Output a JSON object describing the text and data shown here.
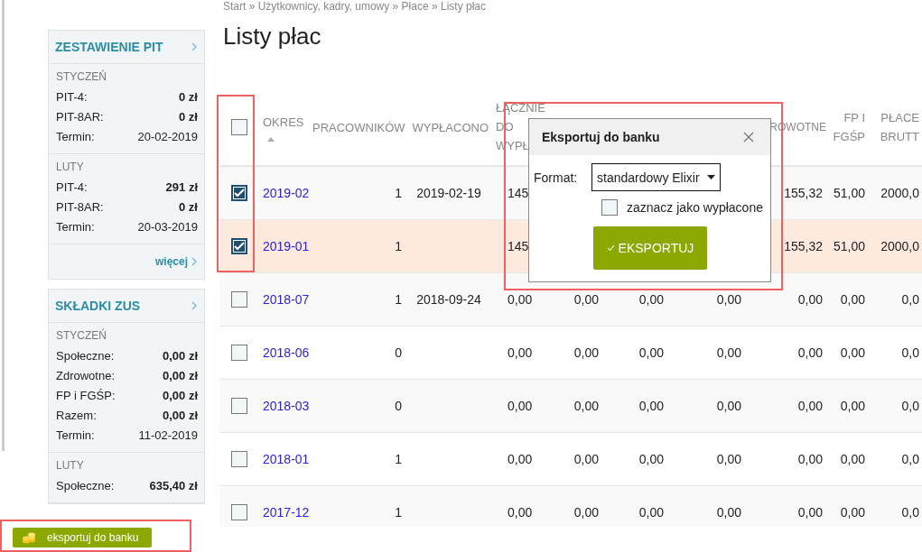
{
  "breadcrumb": "Start » Użytkownicy, kadry, umowy » Płace » Listy płac",
  "sidebar": {
    "panels": [
      {
        "title": "ZESTAWIENIE PIT",
        "sections": [
          {
            "heading": "STYCZEŃ",
            "rows": [
              {
                "label": "PIT-4:",
                "value": "0 zł",
                "bold": true
              },
              {
                "label": "PIT-8AR:",
                "value": "0 zł",
                "bold": true
              },
              {
                "label": "Termin:",
                "value": "20-02-2019",
                "bold": false
              }
            ]
          },
          {
            "heading": "LUTY",
            "rows": [
              {
                "label": "PIT-4:",
                "value": "291 zł",
                "bold": true
              },
              {
                "label": "PIT-8AR:",
                "value": "0 zł",
                "bold": true
              },
              {
                "label": "Termin:",
                "value": "20-03-2019",
                "bold": false
              }
            ]
          }
        ],
        "more": "więcej"
      },
      {
        "title": "SKŁADKI ZUS",
        "sections": [
          {
            "heading": "STYCZEŃ",
            "rows": [
              {
                "label": "Społeczne:",
                "value": "0,00 zł",
                "bold": true
              },
              {
                "label": "Zdrowotne:",
                "value": "0,00 zł",
                "bold": true
              },
              {
                "label": "FP i FGŚP:",
                "value": "0,00 zł",
                "bold": true
              },
              {
                "label": "Razem:",
                "value": "0,00 zł",
                "bold": true
              },
              {
                "label": "Termin:",
                "value": "11-02-2019",
                "bold": false
              }
            ]
          },
          {
            "heading": "LUTY",
            "rows": [
              {
                "label": "Społeczne:",
                "value": "635,40 zł",
                "bold": true
              }
            ]
          }
        ]
      }
    ]
  },
  "page_title": "Listy płac",
  "table": {
    "select_all": {
      "checked": false
    },
    "columns": [
      {
        "label": "OKRES",
        "sorted_ascending": true
      },
      {
        "label": "PRACOWNIKÓW"
      },
      {
        "label": "WYPŁACONO"
      },
      {
        "label": "ŁĄCZNIE DO WYPŁ"
      },
      {},
      {},
      {},
      {
        "label": "ROWOTNE"
      },
      {
        "label": "FP I FGŚP"
      },
      {
        "label": "PŁACE BRUTT"
      }
    ],
    "rows": [
      {
        "checked": true,
        "highlighted": false,
        "cells": [
          "2019-02",
          "1",
          "2019-02-19",
          "145",
          null,
          null,
          null,
          "155,32",
          "51,00",
          "2000,0"
        ]
      },
      {
        "checked": true,
        "highlighted": true,
        "cells": [
          "2019-01",
          "1",
          null,
          "145",
          null,
          null,
          null,
          "155,32",
          "51,00",
          "2000,0"
        ]
      },
      {
        "checked": false,
        "highlighted": false,
        "cells": [
          "2018-07",
          "1",
          "2018-09-24",
          "0,00",
          "0,00",
          "0,00",
          "0,00",
          "0,00",
          "0,00",
          "0,0"
        ]
      },
      {
        "checked": false,
        "highlighted": false,
        "cells": [
          "2018-06",
          "0",
          null,
          "0,00",
          "0,00",
          "0,00",
          "0,00",
          "0,00",
          "0,00",
          "0,0"
        ]
      },
      {
        "checked": false,
        "highlighted": false,
        "cells": [
          "2018-03",
          "0",
          null,
          "0,00",
          "0,00",
          "0,00",
          "0,00",
          "0,00",
          "0,00",
          "0,0"
        ]
      },
      {
        "checked": false,
        "highlighted": false,
        "cells": [
          "2018-01",
          "1",
          null,
          "0,00",
          "0,00",
          "0,00",
          "0,00",
          "0,00",
          "0,00",
          "0,0"
        ]
      },
      {
        "checked": false,
        "highlighted": false,
        "cells": [
          "2017-12",
          "1",
          null,
          "0,00",
          "0,00",
          "0,00",
          "0,00",
          "0,00",
          "0,00",
          "0,0"
        ]
      }
    ]
  },
  "dialog": {
    "title": "Eksportuj do banku",
    "format_label": "Format:",
    "format_value": "standardowy Elixir",
    "mark_paid": {
      "label": "zaznacz jako wypłacone",
      "checked": false
    },
    "button": "EKSPORTUJ"
  },
  "bottom_button": "eksportuj do banku"
}
